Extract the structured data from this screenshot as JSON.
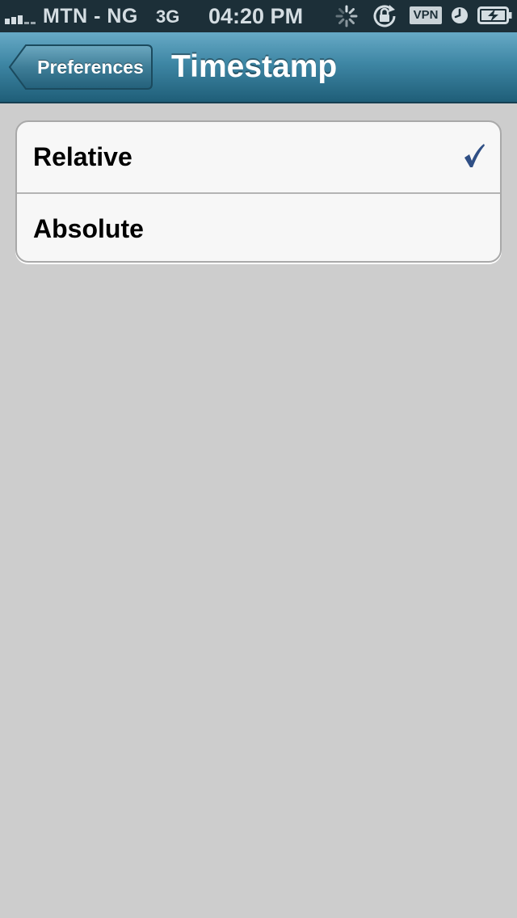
{
  "status_bar": {
    "carrier": "MTN - NG",
    "network": "3G",
    "time": "04:20 PM",
    "vpn_label": "VPN",
    "signal_bars_filled": 3,
    "signal_bars_total": 5,
    "icons": [
      "activity-spinner-icon",
      "rotation-lock-icon",
      "alarm-icon",
      "battery-charging-icon"
    ]
  },
  "nav": {
    "back_label": "Preferences",
    "title": "Timestamp",
    "bar_color": "#3e86a4"
  },
  "options": [
    {
      "label": "Relative",
      "selected": true
    },
    {
      "label": "Absolute",
      "selected": false
    }
  ],
  "colors": {
    "checkmark": "#2f4f85",
    "background": "#cdcdcd",
    "status_bar": "#1c2f38"
  }
}
